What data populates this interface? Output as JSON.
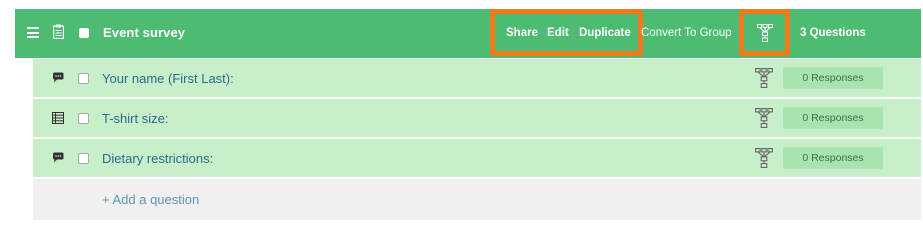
{
  "header": {
    "title": "Event survey",
    "actions": {
      "share": "Share",
      "edit": "Edit",
      "duplicate": "Duplicate",
      "convert": "Convert To Group"
    },
    "question_count": "3 Questions",
    "icons": [
      "hamburger-menu-icon",
      "clipboard-icon",
      "flow-diagram-icon"
    ]
  },
  "questions": [
    {
      "label": "Your name (First Last):",
      "icon": "speech-bubble-icon",
      "responses": "0 Responses"
    },
    {
      "label": "T-shirt size:",
      "icon": "list-icon",
      "responses": "0 Responses"
    },
    {
      "label": "Dietary restrictions:",
      "icon": "speech-bubble-icon",
      "responses": "0 Responses"
    }
  ],
  "add_question": "+ Add a question",
  "colors": {
    "header_bg": "#4dbb72",
    "row_bg": "#c7efc9",
    "highlight": "#f07a1c",
    "link": "#2b6a8e",
    "response_badge": "#a8e4b0"
  }
}
